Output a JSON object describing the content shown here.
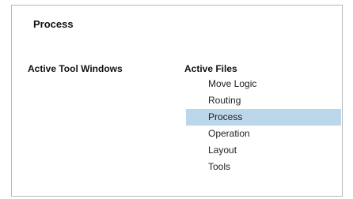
{
  "window": {
    "title": "Process"
  },
  "tool_windows": {
    "header": "Active Tool Windows",
    "items": []
  },
  "active_files": {
    "header": "Active Files",
    "items": [
      {
        "label": "Move Logic",
        "selected": false
      },
      {
        "label": "Routing",
        "selected": false
      },
      {
        "label": "Process",
        "selected": true
      },
      {
        "label": "Operation",
        "selected": false
      },
      {
        "label": "Layout",
        "selected": false
      },
      {
        "label": "Tools",
        "selected": false
      }
    ]
  },
  "colors": {
    "selection": "#bcd6ea",
    "border": "#b8b8b8"
  }
}
